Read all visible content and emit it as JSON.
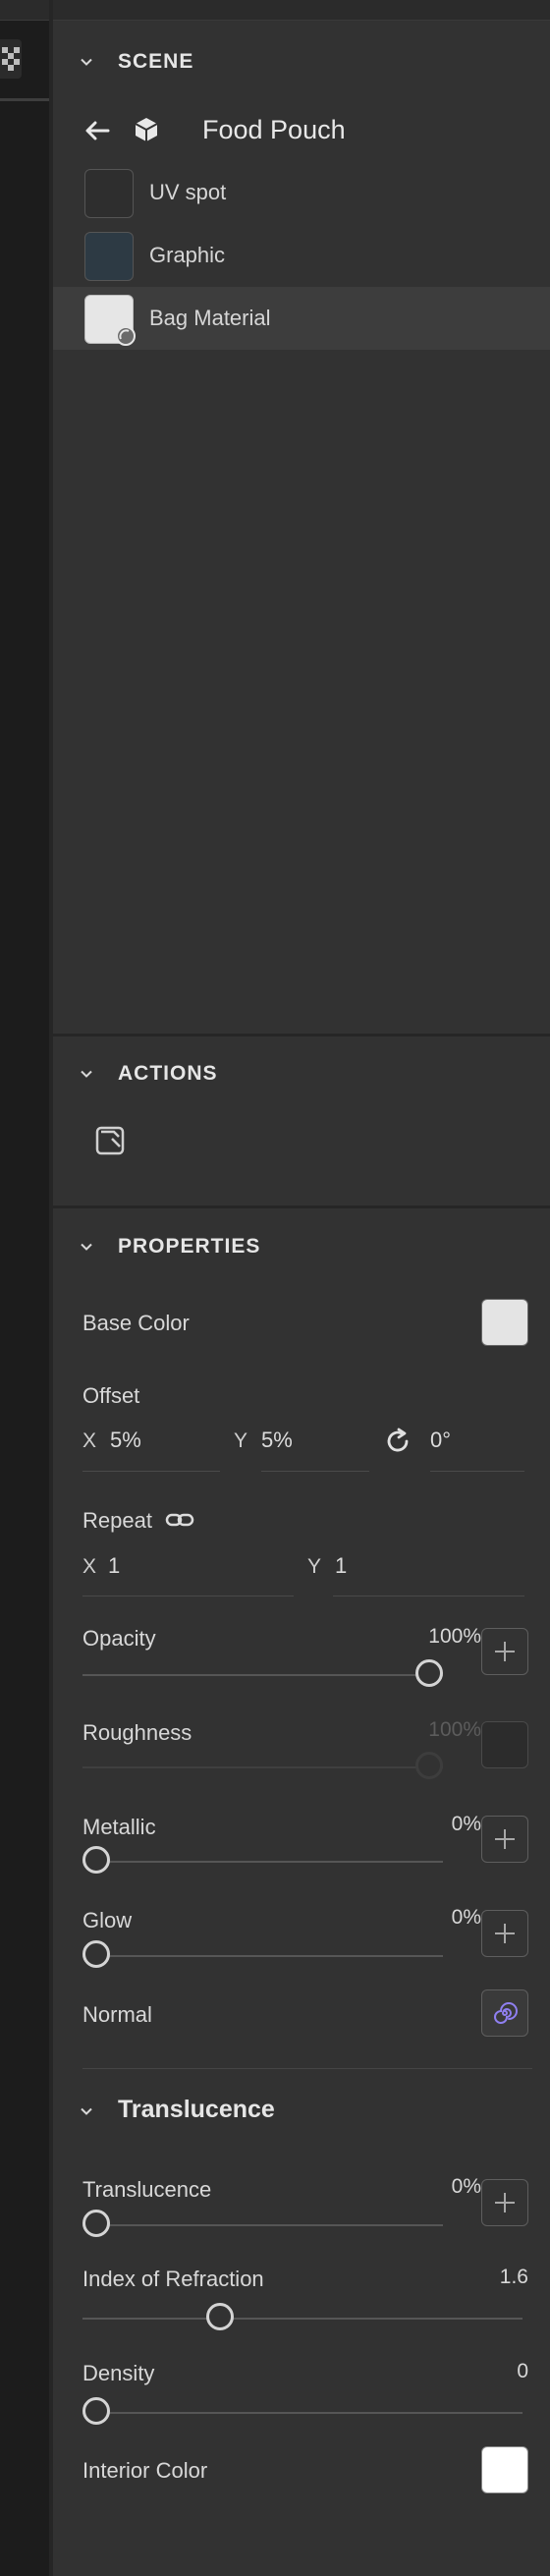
{
  "scene": {
    "section_title": "SCENE",
    "model_name": "Food Pouch",
    "items": [
      {
        "label": "UV spot",
        "thumb_color": "#2e2e2e"
      },
      {
        "label": "Graphic",
        "thumb_color": "#2d3a44"
      },
      {
        "label": "Bag Material",
        "thumb_color": "#e6e6e6",
        "selected": true
      }
    ]
  },
  "actions": {
    "section_title": "ACTIONS",
    "icon": "material-apply-icon"
  },
  "properties": {
    "section_title": "PROPERTIES",
    "base_color": {
      "label": "Base Color",
      "color": "#e4e4e4"
    },
    "offset": {
      "label": "Offset",
      "x_prefix": "X",
      "x_value": "5%",
      "y_prefix": "Y",
      "y_value": "5%",
      "rotation_value": "0°"
    },
    "repeat": {
      "label": "Repeat",
      "x_prefix": "X",
      "x_value": "1",
      "y_prefix": "Y",
      "y_value": "1"
    },
    "opacity": {
      "label": "Opacity",
      "value": "100%",
      "fraction": 1.0
    },
    "roughness": {
      "label": "Roughness",
      "value": "100%",
      "fraction": 1.0
    },
    "metallic": {
      "label": "Metallic",
      "value": "0%",
      "fraction": 0.0
    },
    "glow": {
      "label": "Glow",
      "value": "0%",
      "fraction": 0.0
    },
    "normal": {
      "label": "Normal"
    },
    "translucence_group": {
      "title": "Translucence",
      "translucence": {
        "label": "Translucence",
        "value": "0%",
        "fraction": 0.0
      },
      "ior": {
        "label": "Index of Refraction",
        "value": "1.6",
        "fraction": 0.3
      },
      "density": {
        "label": "Density",
        "value": "0",
        "fraction": 0.0
      },
      "interior_color": {
        "label": "Interior Color",
        "color": "#ffffff"
      }
    }
  },
  "colors": {
    "accent_normal": "#8f7ff0"
  }
}
